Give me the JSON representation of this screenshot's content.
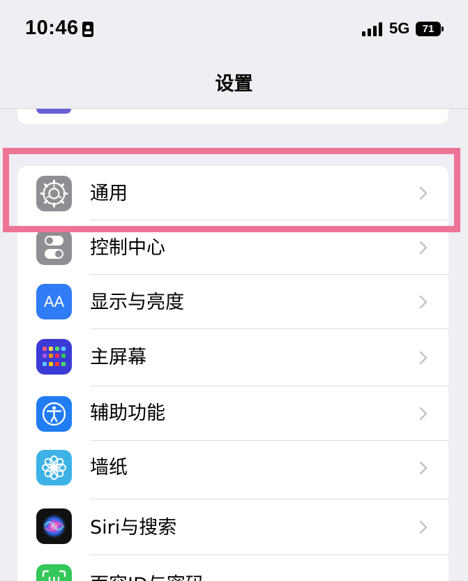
{
  "status_bar": {
    "time": "10:46",
    "network": "5G",
    "battery": "71",
    "icons": [
      "id-card-icon",
      "signal-icon",
      "battery-icon"
    ]
  },
  "nav": {
    "title": "设置"
  },
  "settings": [
    {
      "label": "通用",
      "icon": "gear-icon",
      "icon_color": "#8e8e93"
    },
    {
      "label": "控制中心",
      "icon": "toggle-icon",
      "icon_color": "#8e8e93"
    },
    {
      "label": "显示与亮度",
      "icon": "aa-icon",
      "icon_text": "AA",
      "icon_color": "#2f7cf6"
    },
    {
      "label": "主屏幕",
      "icon": "home-screen-icon",
      "icon_color": "#3a3ad6"
    },
    {
      "label": "辅助功能",
      "icon": "accessibility-icon",
      "icon_color": "#1f7cf3"
    },
    {
      "label": "墙纸",
      "icon": "flower-icon",
      "icon_color": "#3db2e6"
    },
    {
      "label": "Siri与搜索",
      "icon": "siri-icon",
      "icon_color": "#111111"
    },
    {
      "label": "面容ID与密码",
      "icon": "face-id-icon",
      "icon_color": "#34c759"
    }
  ],
  "highlight_color": "#ee7495"
}
